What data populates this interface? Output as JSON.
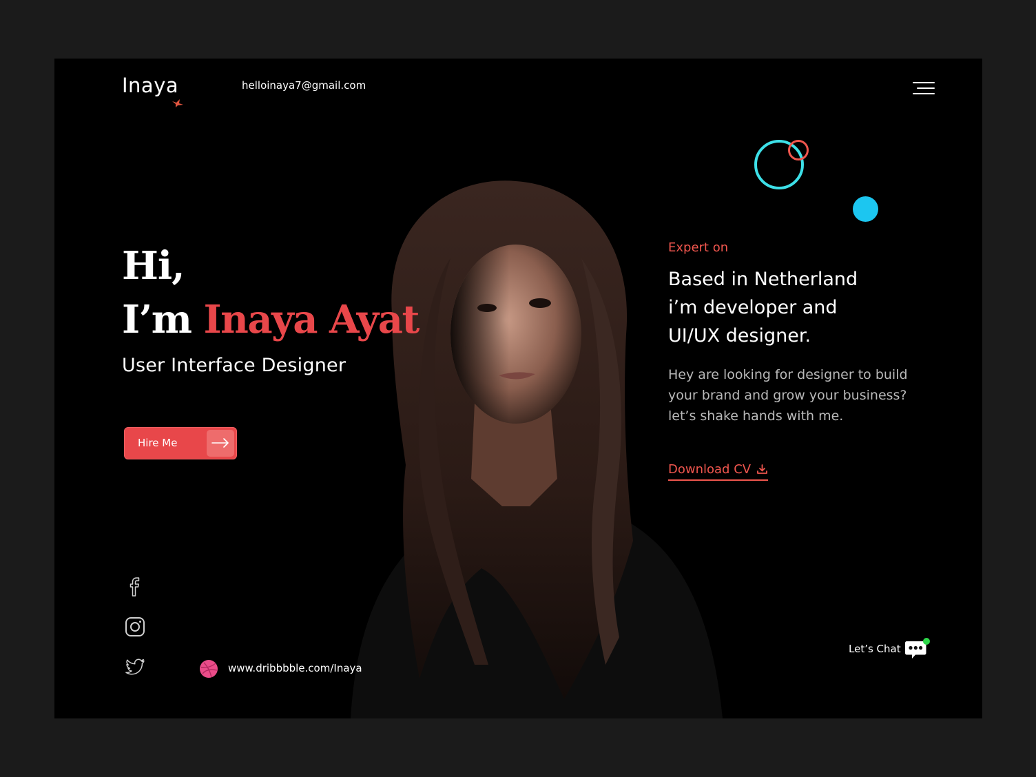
{
  "header": {
    "logo_text": "Inaya",
    "email": "helloinaya7@gmail.com",
    "menu_icon": "hamburger-menu-icon"
  },
  "hero": {
    "greeting": "Hi,",
    "intro_prefix": "I’m",
    "name": "Inaya Ayat",
    "role": "User Interface Designer",
    "hire_button_label": "Hire Me"
  },
  "about": {
    "kicker": "Expert on",
    "headline_line1": "Based in Netherland",
    "headline_line2": "i’m developer and",
    "headline_line3": "UI/UX designer.",
    "description_line1": "Hey are looking for designer to build",
    "description_line2": "your brand and grow your business?",
    "description_line3": "let’s shake hands with me.",
    "download_label": "Download CV"
  },
  "social": {
    "icons": [
      "facebook-icon",
      "instagram-icon",
      "twitter-icon",
      "dribbble-icon"
    ],
    "dribbble_url": "www.dribbbble.com/Inaya"
  },
  "chat": {
    "label": "Let’s Chat",
    "icon": "chat-bubble-icon"
  },
  "colors": {
    "accent": "#e8474a",
    "accent_light": "#f0564e",
    "cyan": "#3de0e8",
    "blue": "#1cc6f0",
    "online": "#2ed84a",
    "background": "#000000"
  }
}
